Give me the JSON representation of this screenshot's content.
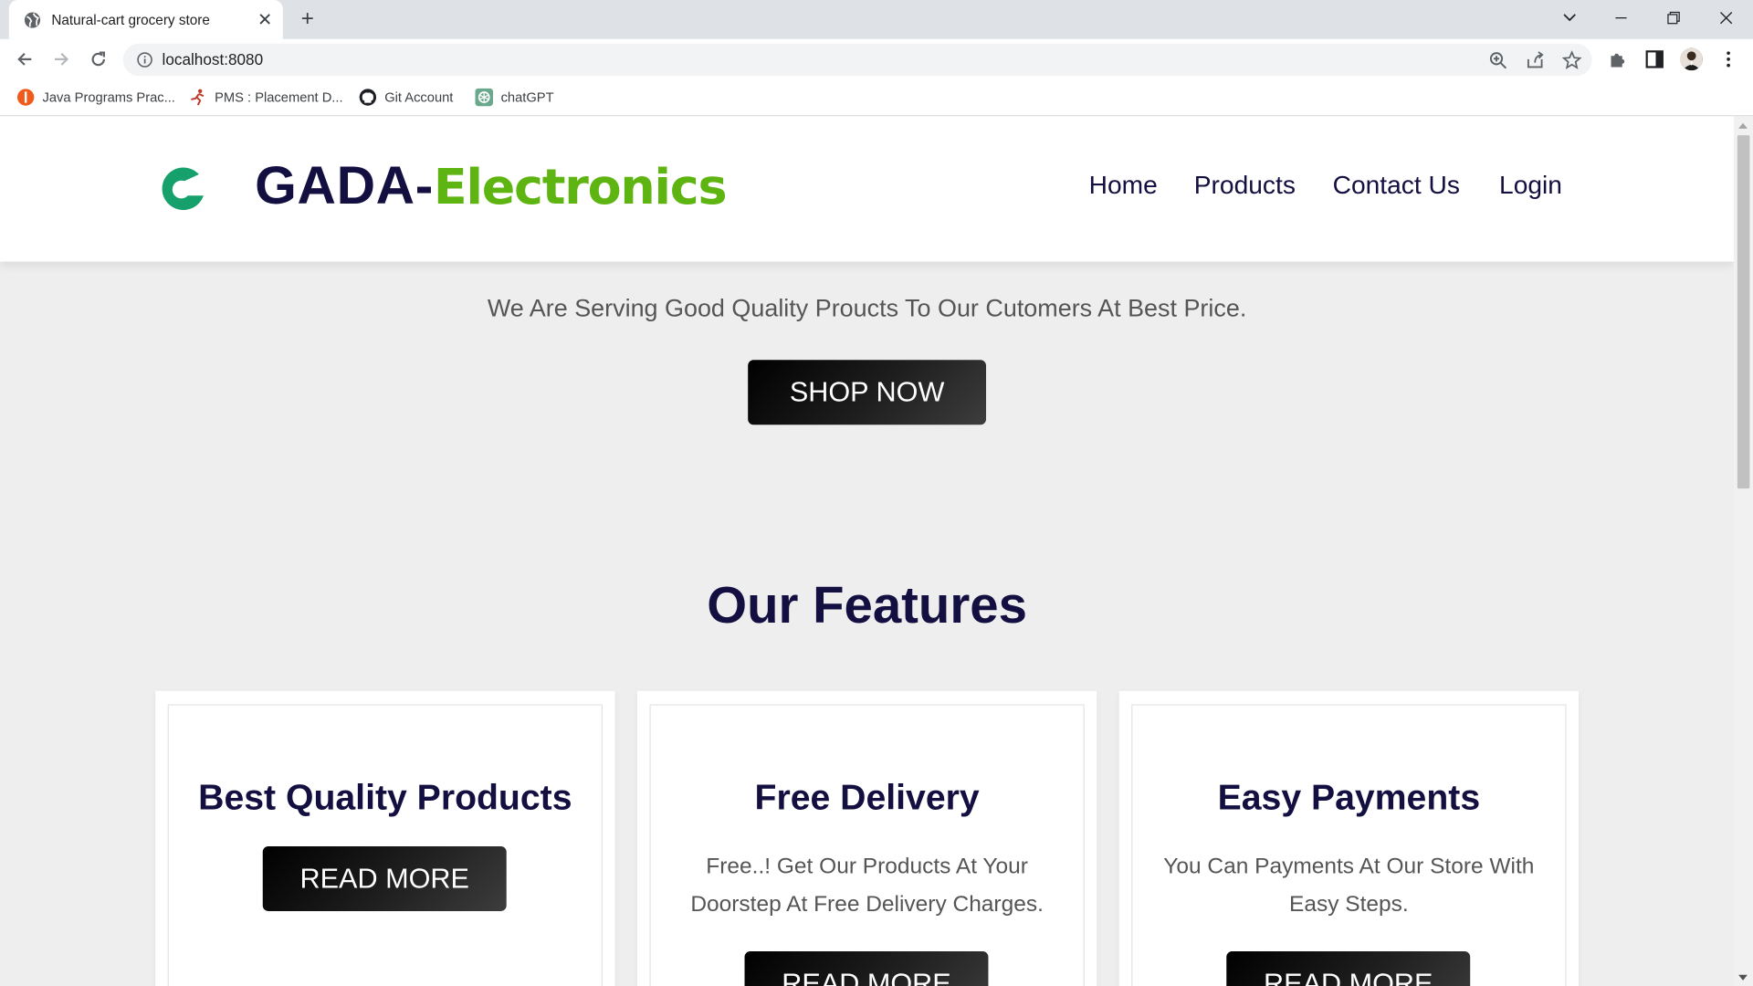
{
  "browser": {
    "tab_title": "Natural-cart grocery store",
    "url": "localhost:8080",
    "bookmarks": [
      {
        "label": "Java Programs Prac...",
        "icon": "java-bookmark-icon"
      },
      {
        "label": "PMS : Placement D...",
        "icon": "runner-bookmark-icon"
      },
      {
        "label": "Git Account",
        "icon": "github-icon"
      },
      {
        "label": "chatGPT",
        "icon": "chatgpt-icon"
      }
    ]
  },
  "header": {
    "brand_main": "GADA-",
    "brand_accent": "Electronics",
    "nav": [
      "Home",
      "Products",
      "Contact Us",
      "Login"
    ]
  },
  "hero": {
    "tagline": "We Are Serving Good Quality Proucts To Our Cutomers At Best Price.",
    "cta": "SHOP NOW"
  },
  "features": {
    "title": "Our Features",
    "cards": [
      {
        "title": "Best Quality Products",
        "description": "",
        "button": "READ MORE"
      },
      {
        "title": "Free Delivery",
        "description": "Free..! Get Our Products At Your Doorstep At Free Delivery Charges.",
        "button": "READ MORE"
      },
      {
        "title": "Easy Payments",
        "description": "You Can Payments At Our Store With Easy Steps.",
        "button": "READ MORE"
      }
    ]
  },
  "colors": {
    "brand_dark": "#130f40",
    "brand_green": "#5eb512",
    "logo_green": "#16a06b",
    "page_bg": "#eeeeee"
  }
}
